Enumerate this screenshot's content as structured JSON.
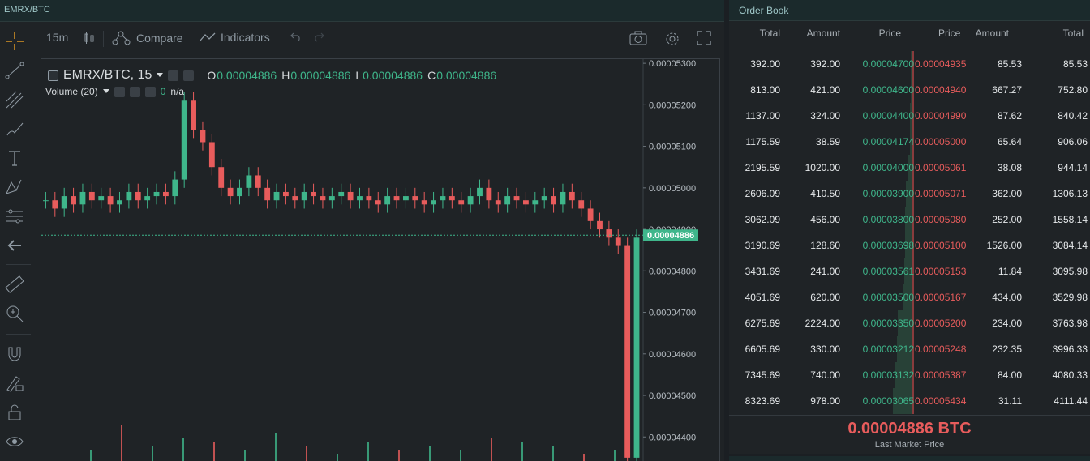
{
  "chart_panel": {
    "title": "EMRX/BTC"
  },
  "toolbar": {
    "interval": "15m",
    "compare_label": "Compare",
    "indicators_label": "Indicators",
    "icons": [
      "bars-icon",
      "compare-icon",
      "indicators-icon",
      "undo-icon",
      "redo-icon",
      "camera-icon",
      "gear-icon",
      "fullscreen-icon"
    ]
  },
  "left_tools": [
    "crosshair-icon",
    "trend-line-icon",
    "pitchfork-icon",
    "brush-icon",
    "text-icon",
    "pattern-icon",
    "measure-icon",
    "back-arrow-icon",
    "ruler-icon",
    "zoom-in-icon",
    "magnet-icon",
    "lock-drawing-icon",
    "unlock-icon",
    "eye-icon"
  ],
  "legend": {
    "symbol": "EMRX/BTC, 15",
    "o_label": "O",
    "o_value": "0.00004886",
    "h_label": "H",
    "h_value": "0.00004886",
    "l_label": "L",
    "l_value": "0.00004886",
    "c_label": "C",
    "c_value": "0.00004886",
    "volume_label": "Volume (20)",
    "volume_value": "0",
    "volume_na": "n/a"
  },
  "colors": {
    "up": "#3fb68b",
    "down": "#e85c5c",
    "bg": "#1f2326"
  },
  "chart_data": {
    "type": "candlestick",
    "y_ticks": [
      "0.00005300",
      "0.00005200",
      "0.00005100",
      "0.00005000",
      "0.00004900",
      "0.00004800",
      "0.00004700",
      "0.00004600",
      "0.00004500",
      "0.00004400"
    ],
    "ylim": [
      4.34e-05,
      5.31e-05
    ],
    "current_price": "0.00004886",
    "close_series": [
      4.97e-05,
      4.95e-05,
      4.98e-05,
      4.96e-05,
      4.99e-05,
      4.97e-05,
      4.98e-05,
      4.96e-05,
      4.97e-05,
      4.99e-05,
      4.97e-05,
      4.98e-05,
      4.99e-05,
      4.98e-05,
      5.02e-05,
      5.21e-05,
      5.14e-05,
      5.11e-05,
      5.05e-05,
      5e-05,
      4.98e-05,
      5e-05,
      5.03e-05,
      5e-05,
      4.97e-05,
      4.99e-05,
      4.98e-05,
      4.97e-05,
      4.99e-05,
      4.98e-05,
      4.97e-05,
      4.98e-05,
      4.99e-05,
      4.97e-05,
      4.98e-05,
      4.97e-05,
      4.96e-05,
      4.98e-05,
      4.97e-05,
      4.98e-05,
      4.97e-05,
      4.96e-05,
      4.97e-05,
      4.98e-05,
      4.97e-05,
      4.96e-05,
      4.98e-05,
      5e-05,
      4.97e-05,
      4.96e-05,
      4.98e-05,
      4.97e-05,
      4.96e-05,
      4.97e-05,
      4.98e-05,
      4.96e-05,
      4.99e-05,
      4.97e-05,
      4.95e-05,
      4.92e-05,
      4.9e-05,
      4.88e-05,
      4.86e-05,
      4.35e-05,
      4.88e-05
    ],
    "volume_spikes": [
      0.3,
      0.9,
      0.4,
      0.6,
      0.5,
      0.3,
      0.7,
      0.4,
      0.2,
      0.5,
      0.3,
      0.4,
      0.3,
      0.6,
      0.5,
      0.4,
      0.2,
      0.3
    ]
  },
  "order_book": {
    "title": "Order Book",
    "headers": [
      "Total",
      "Amount",
      "Price",
      "Price",
      "Amount",
      "Total"
    ],
    "rows": [
      [
        "392.00",
        "392.00",
        "0.00004700",
        "0.00004935",
        "85.53",
        "85.53"
      ],
      [
        "813.00",
        "421.00",
        "0.00004600",
        "0.00004940",
        "667.27",
        "752.80"
      ],
      [
        "1137.00",
        "324.00",
        "0.00004400",
        "0.00004990",
        "87.62",
        "840.42"
      ],
      [
        "1175.59",
        "38.59",
        "0.00004174",
        "0.00005000",
        "65.64",
        "906.06"
      ],
      [
        "2195.59",
        "1020.00",
        "0.00004000",
        "0.00005061",
        "38.08",
        "944.14"
      ],
      [
        "2606.09",
        "410.50",
        "0.00003900",
        "0.00005071",
        "362.00",
        "1306.13"
      ],
      [
        "3062.09",
        "456.00",
        "0.00003800",
        "0.00005080",
        "252.00",
        "1558.14"
      ],
      [
        "3190.69",
        "128.60",
        "0.00003698",
        "0.00005100",
        "1526.00",
        "3084.14"
      ],
      [
        "3431.69",
        "241.00",
        "0.00003561",
        "0.00005153",
        "11.84",
        "3095.98"
      ],
      [
        "4051.69",
        "620.00",
        "0.00003500",
        "0.00005167",
        "434.00",
        "3529.98"
      ],
      [
        "6275.69",
        "2224.00",
        "0.00003350",
        "0.00005200",
        "234.00",
        "3763.98"
      ],
      [
        "6605.69",
        "330.00",
        "0.00003212",
        "0.00005248",
        "232.35",
        "3996.33"
      ],
      [
        "7345.69",
        "740.00",
        "0.00003132",
        "0.00005387",
        "84.00",
        "4080.33"
      ],
      [
        "8323.69",
        "978.00",
        "0.00003065",
        "0.00005434",
        "31.11",
        "4111.44"
      ]
    ],
    "last_price": "0.00004886 BTC",
    "last_price_label": "Last Market Price"
  }
}
